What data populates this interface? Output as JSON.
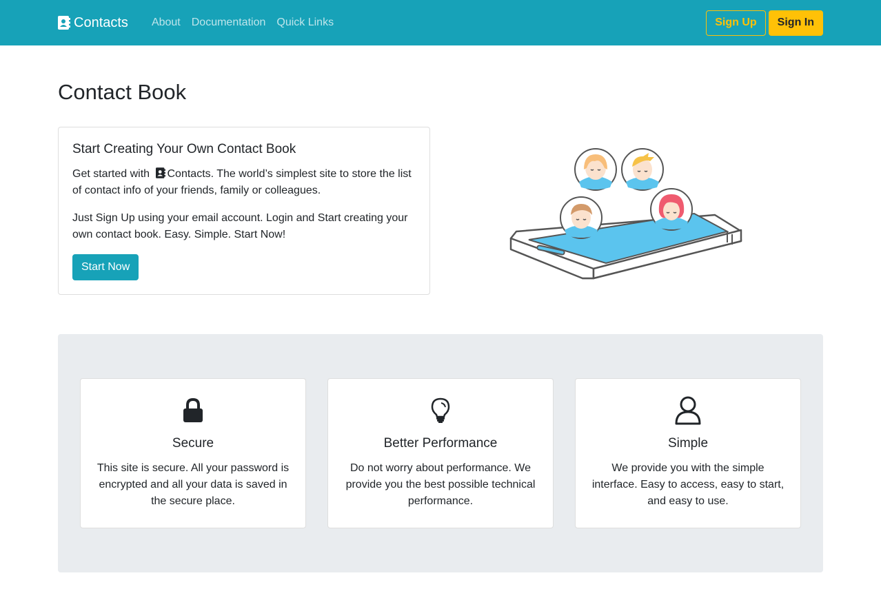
{
  "nav": {
    "brand": "Contacts",
    "brand_icon": "contact-book-icon",
    "links": [
      "About",
      "Documentation",
      "Quick Links"
    ],
    "signup_label": "Sign Up",
    "signin_label": "Sign In"
  },
  "main": {
    "title": "Contact Book",
    "hero_card": {
      "heading": "Start Creating Your Own Contact Book",
      "p1_before": "Get started with",
      "p1_brand": "Contacts. The world’s simplest site to store the list of contact info of your friends, family or colleagues.",
      "p2": "Just Sign Up using your email account. Login and Start creating your own contact book. Easy. Simple. Start Now!",
      "button_label": "Start Now"
    }
  },
  "features": [
    {
      "icon": "lock-icon",
      "title": "Secure",
      "text": "This site is secure. All your password is encrypted and all your data is saved in the secure place."
    },
    {
      "icon": "lightbulb-icon",
      "title": "Better Performance",
      "text": "Do not worry about performance. We provide you the best possible technical performance."
    },
    {
      "icon": "person-icon",
      "title": "Simple",
      "text": "We provide you with the simple interface. Easy to access, easy to start, and easy to use."
    }
  ],
  "colors": {
    "navbar": "#17a2b8",
    "warning": "#ffc107",
    "feature_bg": "#e9ecef"
  }
}
